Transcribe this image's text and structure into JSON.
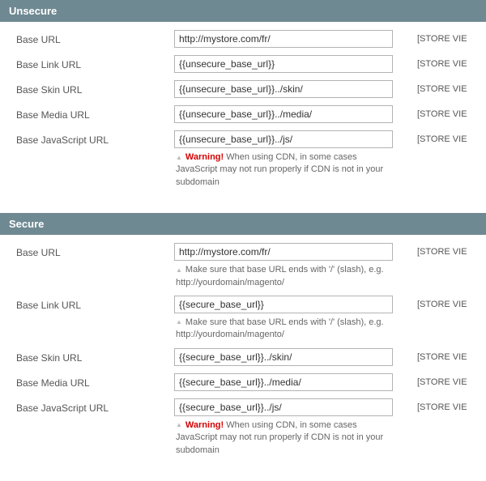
{
  "sections": {
    "unsecure": {
      "title": "Unsecure",
      "fields": {
        "base_url": {
          "label": "Base URL",
          "value": "http://mystore.com/fr/"
        },
        "base_link_url": {
          "label": "Base Link URL",
          "value": "{{unsecure_base_url}}"
        },
        "base_skin_url": {
          "label": "Base Skin URL",
          "value": "{{unsecure_base_url}}../skin/"
        },
        "base_media_url": {
          "label": "Base Media URL",
          "value": "{{unsecure_base_url}}../media/"
        },
        "base_js_url": {
          "label": "Base JavaScript URL",
          "value": "{{unsecure_base_url}}../js/"
        }
      },
      "js_warning_prefix": "Warning!",
      "js_warning_text": " When using CDN, in some cases JavaScript may not run properly if CDN is not in your subdomain"
    },
    "secure": {
      "title": "Secure",
      "fields": {
        "base_url": {
          "label": "Base URL",
          "value": "http://mystore.com/fr/"
        },
        "base_link_url": {
          "label": "Base Link URL",
          "value": "{{secure_base_url}}"
        },
        "base_skin_url": {
          "label": "Base Skin URL",
          "value": "{{secure_base_url}}../skin/"
        },
        "base_media_url": {
          "label": "Base Media URL",
          "value": "{{secure_base_url}}../media/"
        },
        "base_js_url": {
          "label": "Base JavaScript URL",
          "value": "{{secure_base_url}}../js/"
        }
      },
      "base_url_hint": "Make sure that base URL ends with '/' (slash), e.g. http://yourdomain/magento/",
      "js_warning_prefix": "Warning!",
      "js_warning_text": " When using CDN, in some cases JavaScript may not run properly if CDN is not in your subdomain"
    }
  },
  "scope_label": "[STORE VIE"
}
